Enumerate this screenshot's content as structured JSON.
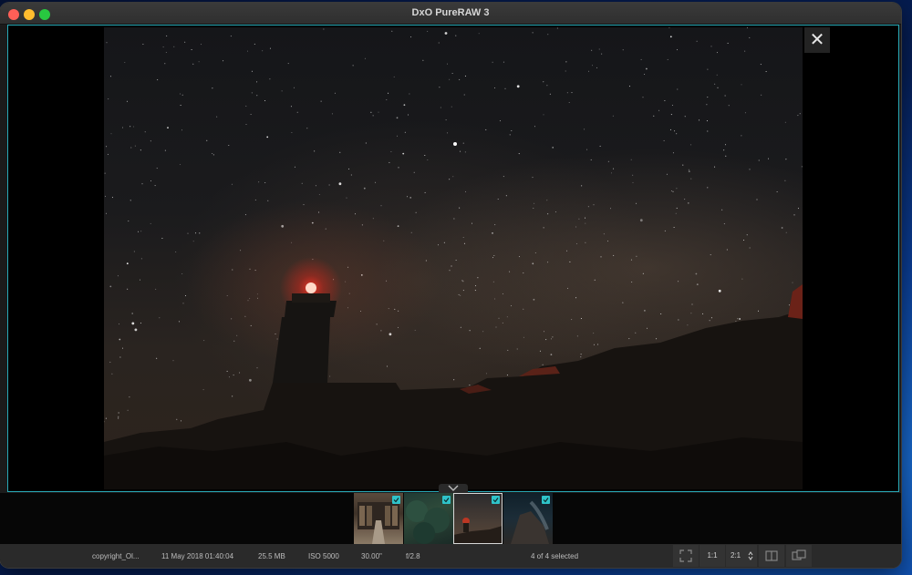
{
  "window": {
    "title": "DxO PureRAW 3"
  },
  "viewer": {
    "close_label": "✕"
  },
  "filmstrip": {
    "thumbs": [
      {
        "name": "library-interior",
        "checked": true,
        "selected": false
      },
      {
        "name": "forest",
        "checked": true,
        "selected": false
      },
      {
        "name": "lighthouse-night",
        "checked": true,
        "selected": true
      },
      {
        "name": "night-sky-rocks",
        "checked": true,
        "selected": false
      }
    ]
  },
  "status": {
    "filename": "copyright_Ol...",
    "date": "11 May 2018 01:40:04",
    "size": "25.5 MB",
    "iso": "ISO 5000",
    "exposure": "30.00\"",
    "aperture": "f/2.8",
    "selection": "4 of 4 selected"
  },
  "toolbar": {
    "fit_icon": "fit-screen-icon",
    "zoom_1_1": "1:1",
    "zoom_2_1": "2:1",
    "compare_icon": "compare-icon",
    "side_by_side_icon": "side-by-side-icon"
  },
  "colors": {
    "accent": "#2fc3c9",
    "viewer_border": "#28a9b6"
  }
}
